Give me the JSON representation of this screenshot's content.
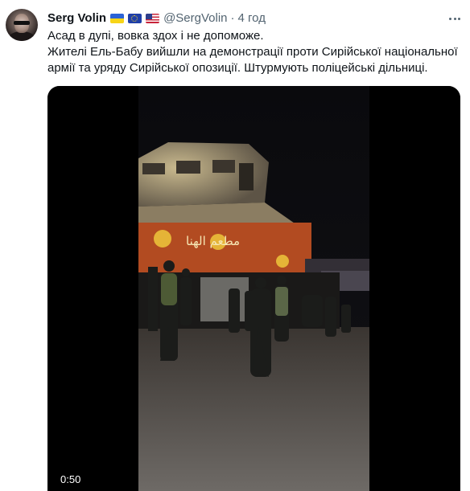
{
  "tweet": {
    "author": {
      "name": "Serg Volin",
      "flags": [
        "ukraine-flag",
        "eu-flag",
        "us-flag"
      ],
      "handle": "@SergVolin",
      "separator": "·",
      "time": "4 год"
    },
    "text": {
      "line1": "Асад в дупі, вовка здох і не допоможе.",
      "line2": "Жителі Ель-Бабу вийшли на демонстрації проти Сирійської національної армії та уряду Сирійської опозиції. Штурмують поліцейські дільниці."
    },
    "media": {
      "type": "video",
      "duration": "0:50",
      "sign_text": "مطعم الهنا"
    },
    "icons": {
      "more": "more-horizontal-icon"
    },
    "colors": {
      "text_primary": "#0f1419",
      "text_secondary": "#536471",
      "video_background": "#000000"
    }
  }
}
